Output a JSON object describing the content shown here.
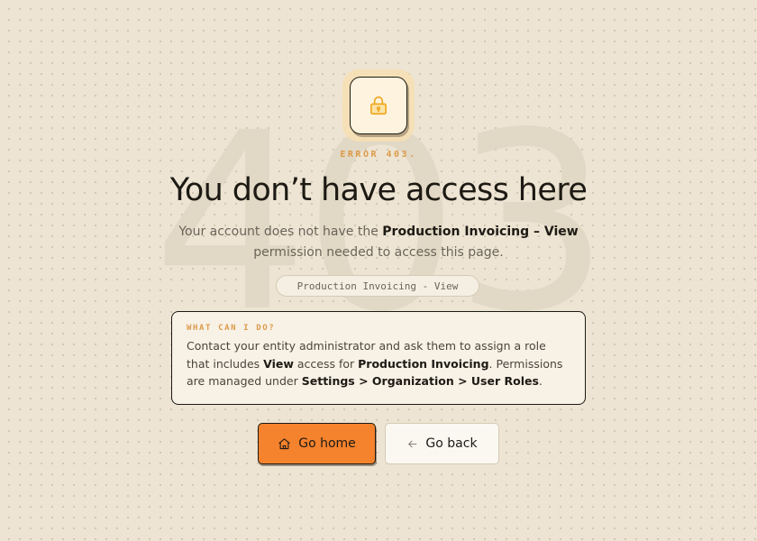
{
  "watermark": "403",
  "icon": {
    "name": "lock-icon",
    "color": "#f0a922"
  },
  "error": {
    "code_label": "ERROR 403."
  },
  "title": "You don’t have access here",
  "subtitle": {
    "pre": "Your account does not have the ",
    "permission": "Production Invoicing – View",
    "post": " permission needed to access this page."
  },
  "permission_pill": "Production Invoicing - View",
  "info_card": {
    "heading": "WHAT CAN I DO?",
    "text_1": "Contact your entity administrator and ask them to assign a role that includes ",
    "bold_1": "View",
    "text_2": " access for ",
    "bold_2": "Production Invoicing",
    "text_3": ". Permissions are managed under ",
    "bold_3": "Settings > Organization > User Roles",
    "text_4": "."
  },
  "actions": {
    "home": {
      "label": "Go home",
      "icon": "home-icon"
    },
    "back": {
      "label": "Go back",
      "icon": "arrow-left-icon"
    }
  },
  "colors": {
    "background": "#ede4d3",
    "accent": "#f5822c",
    "error_label": "#dd9a4a",
    "lock": "#f0a922"
  }
}
